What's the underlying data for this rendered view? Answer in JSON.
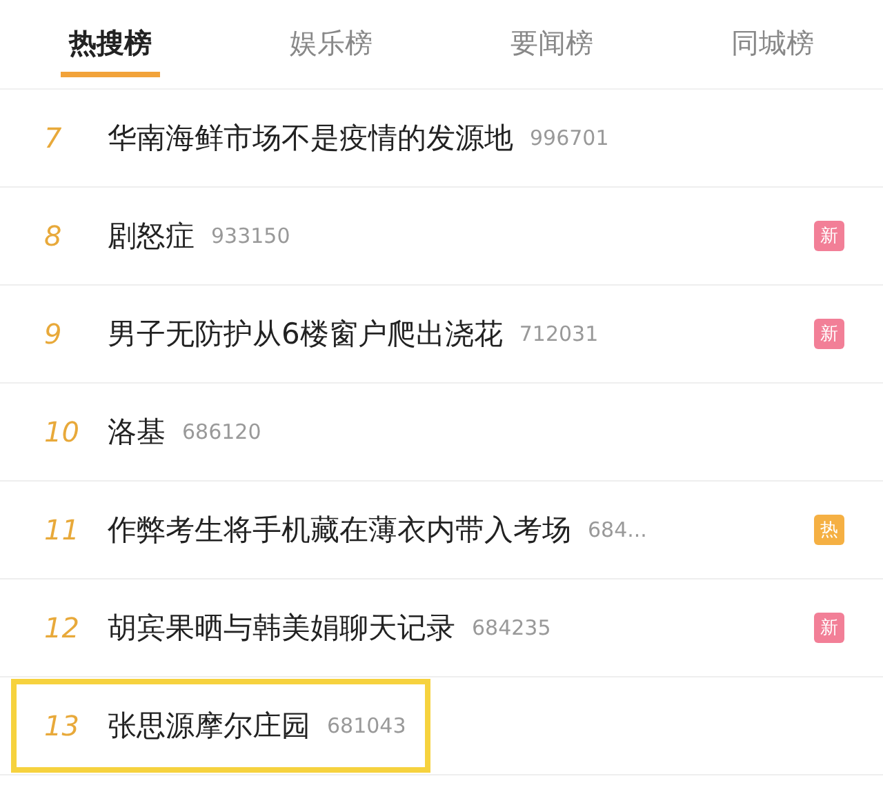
{
  "tabs": [
    {
      "label": "热搜榜",
      "selected": true
    },
    {
      "label": "娱乐榜",
      "selected": false
    },
    {
      "label": "要闻榜",
      "selected": false
    },
    {
      "label": "同城榜",
      "selected": false
    }
  ],
  "rows": [
    {
      "rank": "7",
      "title": "华南海鲜市场不是疫情的发源地",
      "count": "996701",
      "highlighted": false
    },
    {
      "rank": "8",
      "title": "剧怒症",
      "count": "933150",
      "badge": {
        "text": "新",
        "color": "#f27f97"
      },
      "highlighted": false
    },
    {
      "rank": "9",
      "title": "男子无防护从6楼窗户爬出浇花",
      "count": "712031",
      "badge": {
        "text": "新",
        "color": "#f27f97"
      },
      "highlighted": false
    },
    {
      "rank": "10",
      "title": "洛基",
      "count": "686120",
      "highlighted": false
    },
    {
      "rank": "11",
      "title": "作弊考生将手机藏在薄衣内带入考场",
      "count": "684...",
      "badge": {
        "text": "热",
        "color": "#f5b043"
      },
      "highlighted": false
    },
    {
      "rank": "12",
      "title": "胡宾果晒与韩美娟聊天记录",
      "count": "684235",
      "badge": {
        "text": "新",
        "color": "#f27f97"
      },
      "highlighted": false
    },
    {
      "rank": "13",
      "title": "张思源摩尔庄园",
      "count": "681043",
      "highlighted": true
    }
  ]
}
